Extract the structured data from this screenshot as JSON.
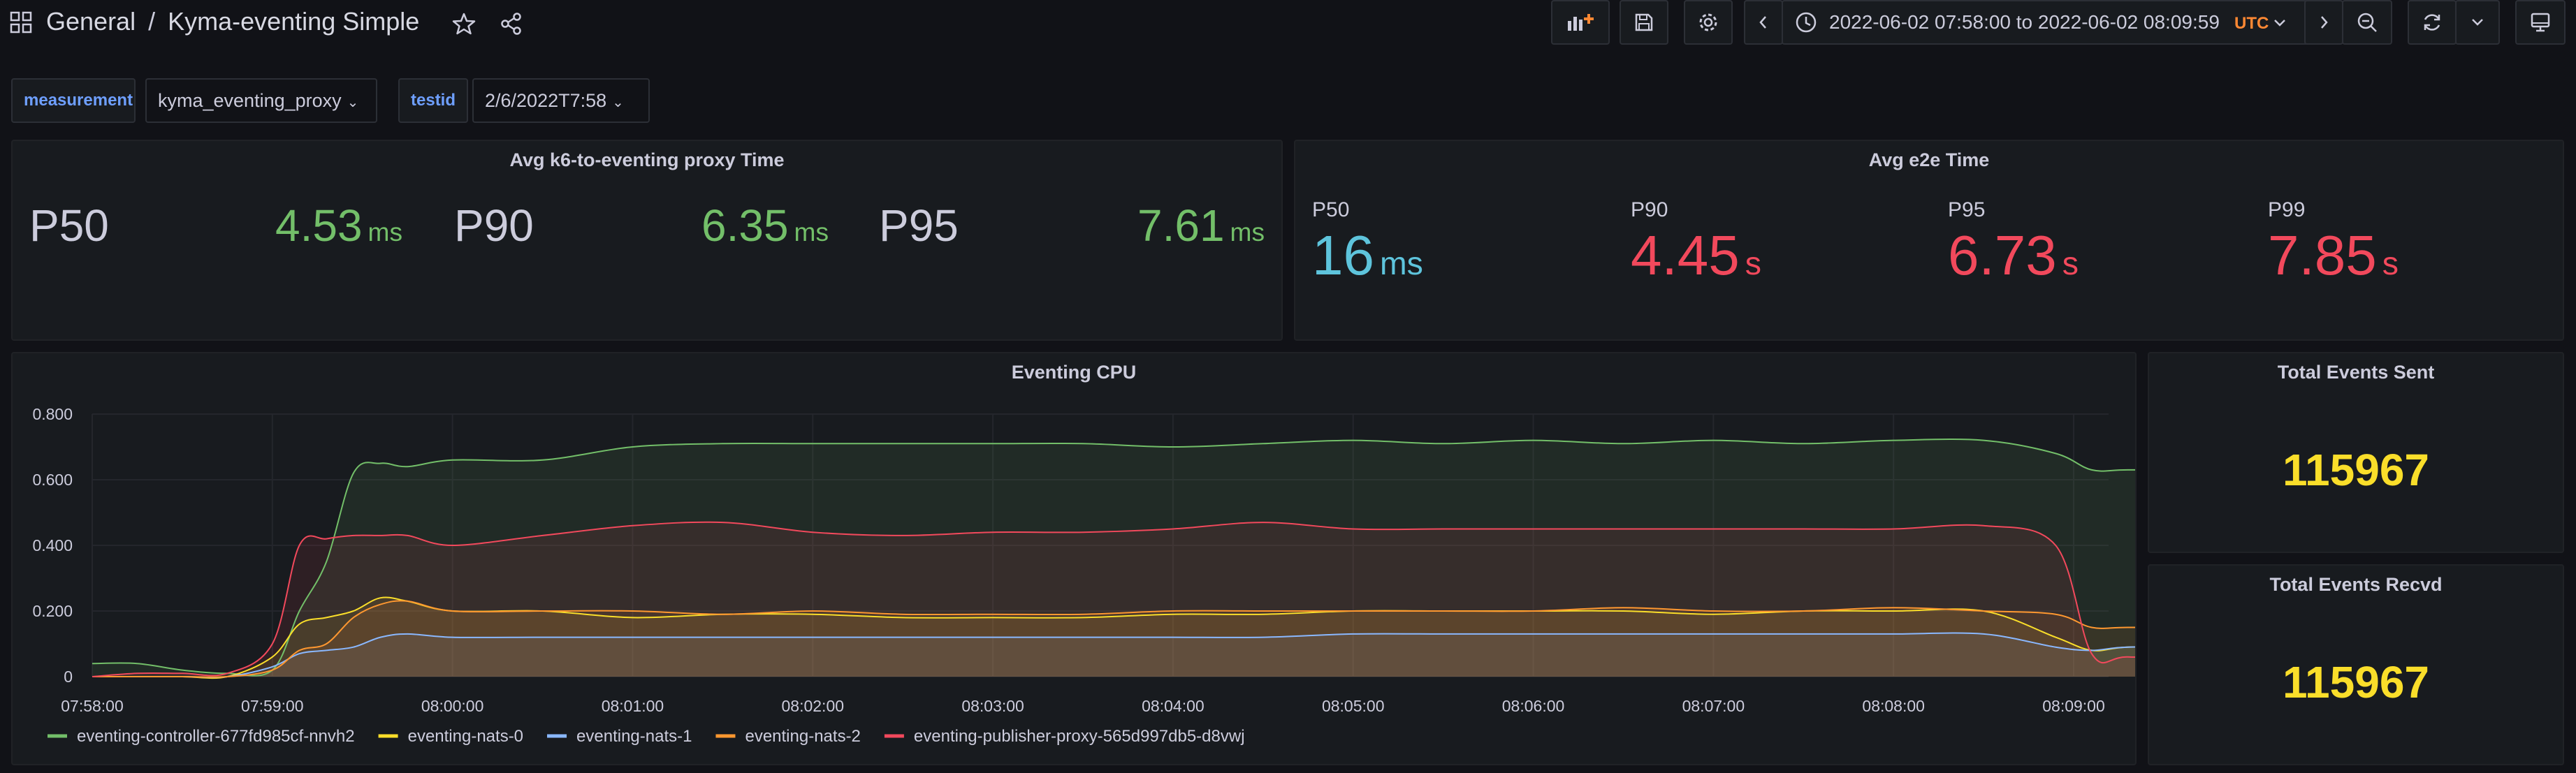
{
  "header": {
    "folder": "General",
    "separator": "/",
    "dashboard_title": "Kyma-eventing Simple",
    "time_range": "2022-06-02 07:58:00 to 2022-06-02 08:09:59",
    "timezone": "UTC"
  },
  "variables": [
    {
      "label": "measurement",
      "value": "kyma_eventing_proxy"
    },
    {
      "label": "testid",
      "value": "2/6/2022T7:58"
    }
  ],
  "panels": {
    "proxy": {
      "title": "Avg k6-to-eventing proxy Time",
      "stats": [
        {
          "name": "P50",
          "value": "4.53",
          "unit": "ms",
          "color": "#73bf69"
        },
        {
          "name": "P90",
          "value": "6.35",
          "unit": "ms",
          "color": "#73bf69"
        },
        {
          "name": "P95",
          "value": "7.61",
          "unit": "ms",
          "color": "#73bf69"
        }
      ]
    },
    "e2e": {
      "title": "Avg e2e Time",
      "stats": [
        {
          "name": "P50",
          "value": "16",
          "unit": "ms",
          "color": "#5ec4dc"
        },
        {
          "name": "P90",
          "value": "4.45",
          "unit": "s",
          "color": "#f2495c"
        },
        {
          "name": "P95",
          "value": "6.73",
          "unit": "s",
          "color": "#f2495c"
        },
        {
          "name": "P99",
          "value": "7.85",
          "unit": "s",
          "color": "#f2495c"
        }
      ]
    },
    "sent": {
      "title": "Total Events Sent",
      "value": "115967"
    },
    "recvd": {
      "title": "Total Events Recvd",
      "value": "115967"
    },
    "cpu": {
      "title": "Eventing CPU"
    }
  },
  "chart_data": {
    "type": "area",
    "title": "Eventing CPU",
    "y_ticks": [
      "0",
      "0.200",
      "0.400",
      "0.600",
      "0.800"
    ],
    "ylim": [
      0,
      0.8
    ],
    "x_ticks": [
      "07:58:00",
      "07:59:00",
      "08:00:00",
      "08:01:00",
      "08:02:00",
      "08:03:00",
      "08:04:00",
      "08:05:00",
      "08:06:00",
      "08:07:00",
      "08:08:00",
      "08:09:00"
    ],
    "x_minutes": [
      0,
      0.25,
      0.5,
      0.75,
      1,
      1.15,
      1.3,
      1.45,
      1.6,
      1.75,
      2,
      2.5,
      3,
      3.5,
      4,
      4.5,
      5,
      5.5,
      6,
      6.5,
      7,
      7.5,
      8,
      8.5,
      9,
      9.5,
      10,
      10.5,
      10.9,
      11.1,
      11.3,
      11.75
    ],
    "series": [
      {
        "name": "eventing-controller-677fd985cf-nnvh2",
        "color": "#73bf69",
        "values": [
          0.04,
          0.04,
          0.02,
          0.01,
          0.02,
          0.2,
          0.35,
          0.62,
          0.65,
          0.64,
          0.66,
          0.66,
          0.7,
          0.71,
          0.71,
          0.71,
          0.71,
          0.71,
          0.7,
          0.71,
          0.72,
          0.71,
          0.72,
          0.71,
          0.72,
          0.71,
          0.72,
          0.72,
          0.68,
          0.63,
          0.63,
          0.63
        ]
      },
      {
        "name": "eventing-nats-0",
        "color": "#fade2a",
        "values": [
          0,
          0,
          0,
          0,
          0.06,
          0.16,
          0.18,
          0.2,
          0.24,
          0.23,
          0.2,
          0.2,
          0.18,
          0.19,
          0.19,
          0.18,
          0.18,
          0.18,
          0.19,
          0.19,
          0.2,
          0.2,
          0.2,
          0.2,
          0.19,
          0.2,
          0.2,
          0.2,
          0.12,
          0.08,
          0.09,
          0.09
        ]
      },
      {
        "name": "eventing-nats-1",
        "color": "#8ab8ff",
        "values": [
          0,
          0,
          0,
          0,
          0.03,
          0.07,
          0.08,
          0.09,
          0.12,
          0.13,
          0.12,
          0.12,
          0.12,
          0.12,
          0.12,
          0.12,
          0.12,
          0.12,
          0.12,
          0.12,
          0.13,
          0.13,
          0.13,
          0.13,
          0.13,
          0.13,
          0.13,
          0.13,
          0.09,
          0.08,
          0.09,
          0.09
        ]
      },
      {
        "name": "eventing-nats-2",
        "color": "#ff9830",
        "values": [
          0,
          0,
          0,
          0,
          0.02,
          0.08,
          0.1,
          0.18,
          0.22,
          0.23,
          0.2,
          0.2,
          0.2,
          0.19,
          0.2,
          0.19,
          0.19,
          0.19,
          0.2,
          0.2,
          0.2,
          0.2,
          0.2,
          0.21,
          0.2,
          0.2,
          0.21,
          0.2,
          0.19,
          0.15,
          0.15,
          0.15
        ]
      },
      {
        "name": "eventing-publisher-proxy-565d997db5-d8vwj",
        "color": "#f2495c",
        "values": [
          0,
          0.01,
          0.01,
          0.01,
          0.1,
          0.4,
          0.42,
          0.43,
          0.43,
          0.43,
          0.4,
          0.43,
          0.46,
          0.47,
          0.44,
          0.43,
          0.44,
          0.44,
          0.45,
          0.47,
          0.45,
          0.45,
          0.45,
          0.45,
          0.45,
          0.45,
          0.45,
          0.46,
          0.4,
          0.07,
          0.06,
          0.06
        ]
      }
    ],
    "legend_placement": "bottom-left",
    "grid": true
  }
}
